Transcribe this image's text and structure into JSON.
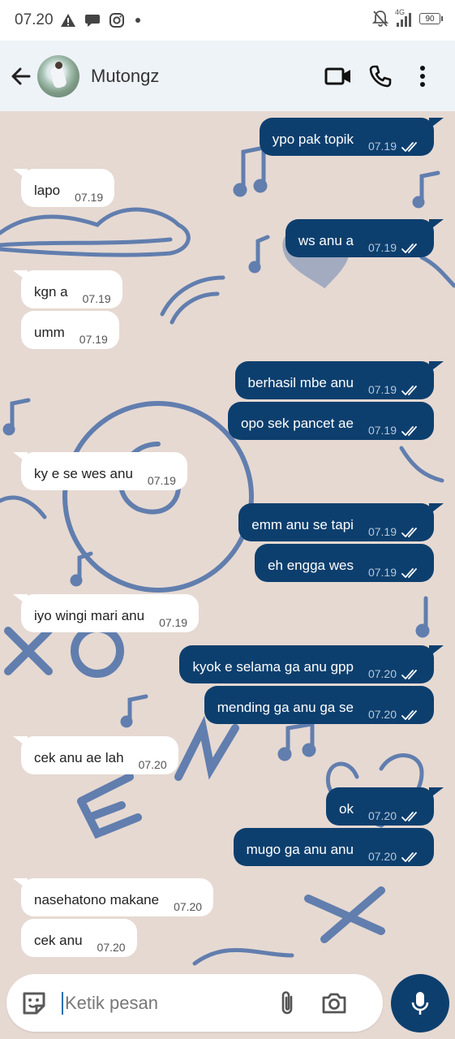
{
  "status_bar": {
    "time": "07.20",
    "network_label": "4G",
    "battery": "90",
    "icons": [
      "alert-icon",
      "chat-icon",
      "instagram-icon",
      "dot-icon",
      "mute-icon",
      "signal-icon",
      "battery-icon"
    ]
  },
  "header": {
    "contact_name": "Mutongz",
    "icons": [
      "back-arrow-icon",
      "video-call-icon",
      "phone-icon",
      "more-vertical-icon"
    ]
  },
  "messages": [
    {
      "dir": "out",
      "text": "ypo pak topik",
      "time": "07.19"
    },
    {
      "dir": "in",
      "text": "lapo",
      "time": "07.19"
    },
    {
      "dir": "out",
      "text": "ws anu a",
      "time": "07.19"
    },
    {
      "dir": "in",
      "text": "kgn a",
      "time": "07.19"
    },
    {
      "dir": "in",
      "text": "umm",
      "time": "07.19"
    },
    {
      "dir": "out",
      "text": "berhasil mbe anu",
      "time": "07.19"
    },
    {
      "dir": "out",
      "text": "opo sek pancet ae",
      "time": "07.19"
    },
    {
      "dir": "in",
      "text": "ky e se wes anu",
      "time": "07.19"
    },
    {
      "dir": "out",
      "text": "emm anu se tapi",
      "time": "07.19"
    },
    {
      "dir": "out",
      "text": "eh engga wes",
      "time": "07.19"
    },
    {
      "dir": "in",
      "text": "iyo wingi mari anu",
      "time": "07.19"
    },
    {
      "dir": "out",
      "text": "kyok e selama ga anu gpp",
      "time": "07.20"
    },
    {
      "dir": "out",
      "text": "mending ga anu ga se",
      "time": "07.20"
    },
    {
      "dir": "in",
      "text": "cek anu ae lah",
      "time": "07.20"
    },
    {
      "dir": "out",
      "text": "ok",
      "time": "07.20"
    },
    {
      "dir": "out",
      "text": "mugo ga anu anu",
      "time": "07.20"
    },
    {
      "dir": "in",
      "text": "nasehatono makane",
      "time": "07.20"
    },
    {
      "dir": "in",
      "text": "cek anu",
      "time": "07.20"
    }
  ],
  "input": {
    "placeholder": "Ketik pesan",
    "icons": [
      "emoji-icon",
      "attach-icon",
      "camera-icon",
      "mic-icon"
    ]
  },
  "colors": {
    "outgoing_bubble": "#0d3f6e",
    "incoming_bubble": "#ffffff",
    "header_bg": "#eef3f8",
    "wallpaper_bg": "#e6d9d2",
    "wallpaper_ink": "#4a6ea8"
  }
}
